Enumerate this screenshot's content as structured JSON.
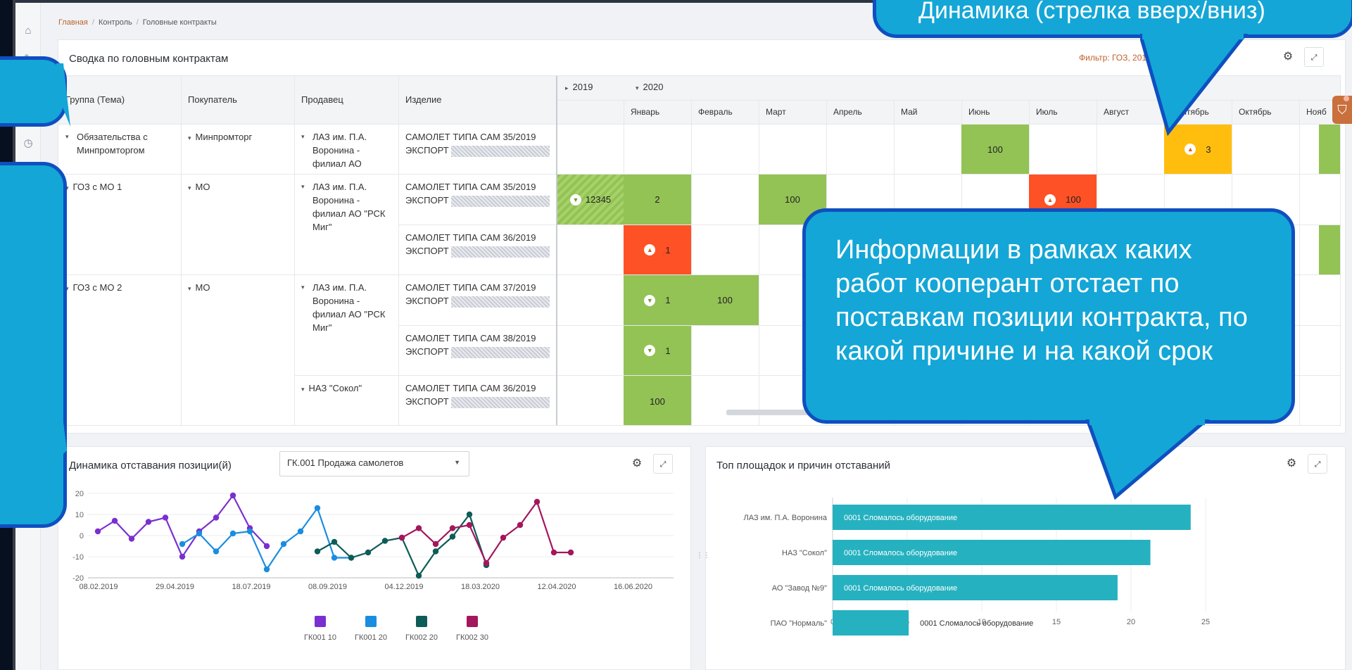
{
  "breadcrumb": {
    "home": "Главная",
    "control": "Контроль",
    "current": "Головные контракты"
  },
  "sidebar": {
    "icons": [
      "home-icon",
      "tasks-icon",
      "list-icon",
      "calendar-icon",
      "clipboard-icon",
      "chart-icon"
    ]
  },
  "summary": {
    "title": "Сводка по головным контрактам",
    "filter": "Фильтр: ГОЗ, 2019-",
    "columns": {
      "group": "Группа (Тема)",
      "buyer": "Покупатель",
      "seller": "Продавец",
      "product": "Изделие"
    },
    "years": [
      "2019",
      "2020"
    ],
    "months": [
      "Январь",
      "Февраль",
      "Март",
      "Апрель",
      "Май",
      "Июнь",
      "Июль",
      "Август",
      "Сентябрь",
      "Октябрь",
      "Нояб"
    ],
    "groups": [
      {
        "group": "Обязательства с Минпромторгом",
        "buyer": "Минпромторг",
        "seller": "ЛАЗ им. П.А. Воронина - филиал АО"
      },
      {
        "group": "ГОЗ с МО 1",
        "buyer": "МО",
        "seller": "ЛАЗ им. П.А. Воронина - филиал АО \"РСК Миг\""
      },
      {
        "group": "ГОЗ с МО 2",
        "buyer": "МО",
        "seller": "ЛАЗ им. П.А. Воронина - филиал АО \"РСК Миг\"",
        "seller2": "НАЗ \"Сокол\""
      }
    ],
    "products": [
      {
        "name": "САМОЛЕТ ТИПА САМ 35/2019",
        "suffix": "ЭКСПОРТ"
      },
      {
        "name": "САМОЛЕТ ТИПА САМ 35/2019",
        "suffix": "ЭКСПОРТ"
      },
      {
        "name": "САМОЛЕТ ТИПА САМ 36/2019",
        "suffix": "ЭКСПОРТ"
      },
      {
        "name": "САМОЛЕТ ТИПА САМ 37/2019",
        "suffix": "ЭКСПОРТ"
      },
      {
        "name": "САМОЛЕТ ТИПА САМ 38/2019",
        "suffix": "ЭКСПОРТ"
      },
      {
        "name": "САМОЛЕТ ТИПА САМ 36/2019",
        "suffix": "ЭКСПОРТ"
      }
    ],
    "values": {
      "r1_jun": "100",
      "r1_sep": "3",
      "r2_2019": "12345",
      "r2_jan": "2",
      "r2_mar": "100",
      "r2_jul": "100",
      "r3_jan": "1",
      "r4_jan": "1",
      "r4_feb": "100",
      "r5_jan": "1",
      "r6_jan": "100"
    }
  },
  "lag_chart": {
    "title": "Динамика отставания позиции(й)",
    "select_value": "ГК.001 Продажа самолетов",
    "chart_data": {
      "type": "line",
      "yticks": [
        "20",
        "10",
        "0",
        "-10",
        "-20"
      ],
      "xticks": [
        "08.02.2019",
        "29.04.2019",
        "18.07.2019",
        "08.09.2019",
        "04.12.2019",
        "18.03.2020",
        "12.04.2020",
        "16.06.2020"
      ],
      "ylim": [
        -20,
        20
      ],
      "series": [
        {
          "name": "ГК001 10",
          "color": "#7a2fd0",
          "x": [
            0,
            1,
            2,
            3,
            4,
            5,
            6,
            7,
            8,
            9,
            10
          ],
          "y": [
            2,
            7,
            -1.5,
            6.5,
            8.5,
            -10,
            2,
            8.5,
            19,
            3.5,
            -5
          ]
        },
        {
          "name": "ГК001 20",
          "color": "#1b8de0",
          "x": [
            5,
            6,
            7,
            8,
            9,
            10,
            11,
            12,
            13,
            14,
            15
          ],
          "y": [
            -4,
            1,
            -7.5,
            1,
            2,
            -16,
            -4,
            2,
            13,
            -10.5,
            -10.5
          ]
        },
        {
          "name": "ГК002 20",
          "color": "#0d5c57",
          "x": [
            13,
            14,
            15,
            16,
            17,
            18,
            19,
            20,
            21,
            22,
            23
          ],
          "y": [
            -7.5,
            -3,
            -10.5,
            -8,
            -2.5,
            -1,
            -19,
            -7.5,
            -0.5,
            10,
            -14
          ]
        },
        {
          "name": "ГК002 30",
          "color": "#a3175c",
          "x": [
            18,
            19,
            20,
            21,
            22,
            23,
            24,
            25,
            26,
            27,
            28
          ],
          "y": [
            -1,
            3.5,
            -4,
            3.5,
            5,
            -13,
            -1,
            5,
            16,
            -8,
            -8
          ]
        }
      ]
    }
  },
  "top_chart": {
    "title": "Топ площадок и причин отставаний",
    "chart_data": {
      "type": "bar",
      "categories": [
        "ЛАЗ им. П.А. Воронина",
        "НАЗ \"Сокол\"",
        "АО \"Завод №9\"",
        "ПАО \"Нормаль\""
      ],
      "values": [
        24,
        21.3,
        19.1,
        5.1
      ],
      "bar_labels": [
        "0001 Сломалось оборудование",
        "0001 Сломалось оборудование",
        "0001 Сломалось оборудование",
        "0001 Сломалось оборудование"
      ],
      "xticks": [
        "0",
        "5",
        "10",
        "15",
        "20",
        "25"
      ],
      "xlim": [
        0,
        25
      ],
      "color": "#26b1c0"
    }
  },
  "callouts": {
    "top": "Динамика (стрелка вверх/вниз)",
    "middle": "Информации в рамках каких работ кооперант отстает по поставкам позиции контракта, по какой причине и на какой срок"
  }
}
